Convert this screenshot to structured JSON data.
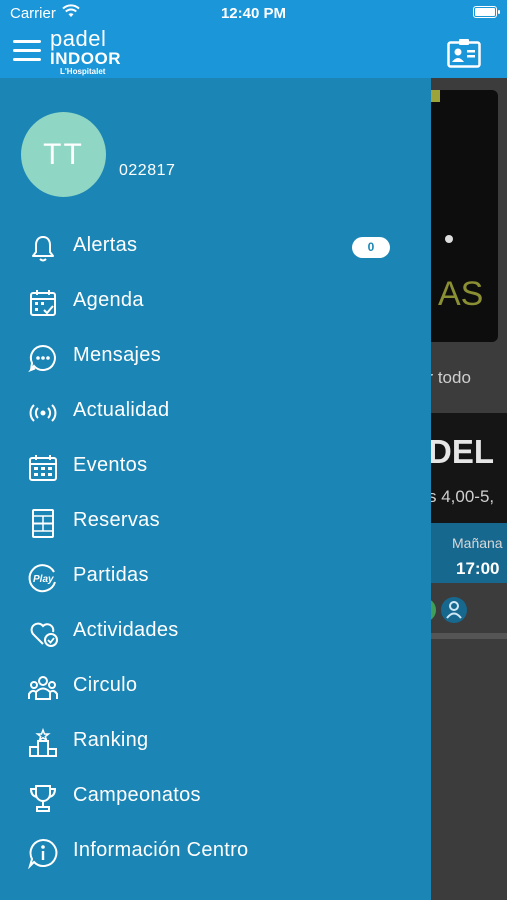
{
  "status_bar": {
    "carrier": "Carrier",
    "time": "12:40 PM"
  },
  "app": {
    "logo": {
      "line1": "padel",
      "line2": "INDOOR",
      "line3": "L'Hospitalet"
    },
    "colors": {
      "header": "#1b96d9",
      "drawer": "#1b86b5",
      "avatar": "#8fd6c4"
    }
  },
  "profile": {
    "initials": "TT",
    "user_id": "022817"
  },
  "menu": [
    {
      "label": "Alertas",
      "icon": "bell-icon",
      "badge": "0"
    },
    {
      "label": "Agenda",
      "icon": "calendar-check-icon"
    },
    {
      "label": "Mensajes",
      "icon": "chat-bubble-icon"
    },
    {
      "label": "Actualidad",
      "icon": "broadcast-icon"
    },
    {
      "label": "Eventos",
      "icon": "calendar-grid-icon"
    },
    {
      "label": "Reservas",
      "icon": "court-icon"
    },
    {
      "label": "Partidas",
      "icon": "play-badge-icon"
    },
    {
      "label": "Actividades",
      "icon": "heart-check-icon"
    },
    {
      "label": "Circulo",
      "icon": "group-icon"
    },
    {
      "label": "Ranking",
      "icon": "podium-icon"
    },
    {
      "label": "Campeonatos",
      "icon": "trophy-icon"
    },
    {
      "label": "Información Centro",
      "icon": "info-bubble-icon"
    }
  ],
  "background": {
    "banner_text": "AS",
    "ver_todo": "er todo",
    "card_title": "DEL",
    "card_subtitle": "s 4,00-5,",
    "slot_day": "Mañana",
    "slot_time": "17:00"
  }
}
